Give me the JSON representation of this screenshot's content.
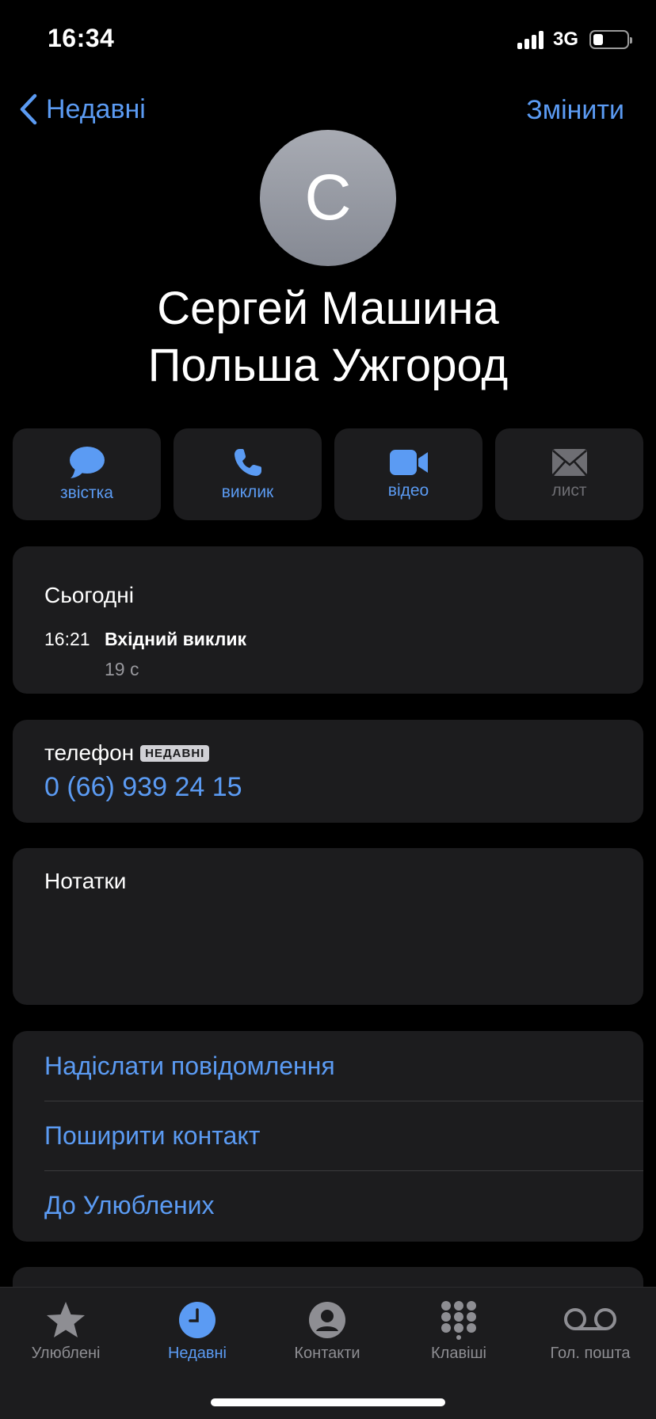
{
  "status": {
    "time": "16:34",
    "network": "3G",
    "battery_level": 0.3
  },
  "nav": {
    "back_label": "Недавні",
    "edit_label": "Змінити"
  },
  "contact": {
    "initial": "С",
    "name_line1": "Сергей Машина",
    "name_line2": "Польша Ужгород"
  },
  "actions": [
    {
      "label": "звістка",
      "icon": "message-bubble-icon",
      "enabled": true
    },
    {
      "label": "виклик",
      "icon": "phone-icon",
      "enabled": true
    },
    {
      "label": "відео",
      "icon": "video-camera-icon",
      "enabled": true
    },
    {
      "label": "лист",
      "icon": "mail-envelope-icon",
      "enabled": false
    }
  ],
  "history": {
    "title": "Сьогодні",
    "time": "16:21",
    "type": "Вхідний виклик",
    "duration": "19 с"
  },
  "phone": {
    "label": "телефон",
    "badge": "НЕДАВНІ",
    "number": "0 (66) 939 24 15"
  },
  "notes": {
    "title": "Нотатки"
  },
  "links": [
    "Надіслати повідомлення",
    "Поширити контакт",
    "До Улюблених"
  ],
  "tabs": [
    {
      "label": "Улюблені",
      "icon": "star-icon",
      "active": false
    },
    {
      "label": "Недавні",
      "icon": "clock-icon",
      "active": true
    },
    {
      "label": "Контакти",
      "icon": "person-circle-icon",
      "active": false
    },
    {
      "label": "Клавіші",
      "icon": "keypad-icon",
      "active": false
    },
    {
      "label": "Гол. пошта",
      "icon": "voicemail-icon",
      "active": false
    }
  ],
  "colors": {
    "accent": "#5b9bf3",
    "card": "#1c1c1e",
    "background": "#000000",
    "secondary_text": "#98989d"
  }
}
